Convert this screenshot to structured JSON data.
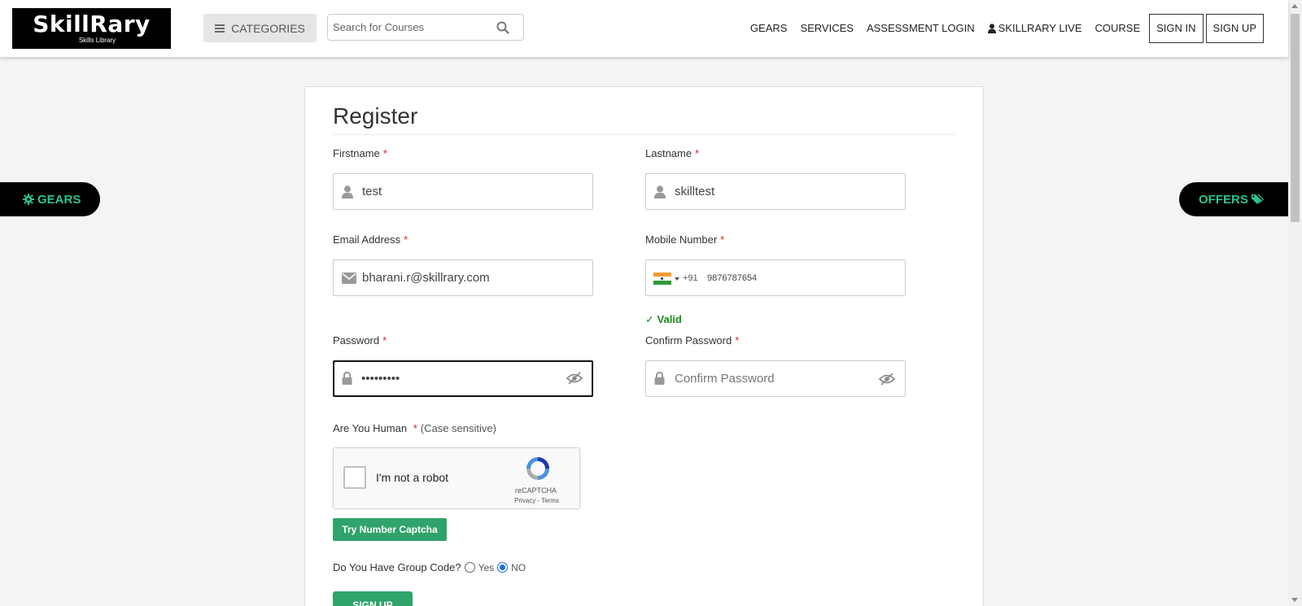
{
  "header": {
    "logo_text": "SkillRary",
    "logo_tagline": "Skills Library",
    "categories_label": "CATEGORIES",
    "search_placeholder": "Search for Courses",
    "nav": {
      "gears": "GEARS",
      "services": "SERVICES",
      "assessment": "ASSESSMENT LOGIN",
      "live": "SKILLRARY LIVE",
      "course": "COURSE",
      "signin": "SIGN IN",
      "signup": "SIGN UP"
    }
  },
  "side": {
    "left_label": "GEARS",
    "right_label": "OFFERS"
  },
  "form": {
    "title": "Register",
    "required_mark": "*",
    "firstname": {
      "label": "Firstname",
      "value": "test"
    },
    "lastname": {
      "label": "Lastname",
      "value": "skilltest"
    },
    "email": {
      "label": "Email Address",
      "value": "bharani.r@skillrary.com"
    },
    "mobile": {
      "label": "Mobile Number",
      "dial_code": "+91",
      "value": "9876787654",
      "status": "✓ Valid"
    },
    "password": {
      "label": "Password",
      "value": "•••••••••"
    },
    "confirm_password": {
      "label": "Confirm Password",
      "placeholder": "Confirm Password"
    },
    "captcha": {
      "label": "Are You Human",
      "hint": "(Case sensitive)",
      "checkbox_text": "I'm not a robot",
      "brand": "reCAPTCHA",
      "terms": "Privacy - Terms"
    },
    "try_number_captcha": "Try Number Captcha",
    "group_code": {
      "label": "Do You Have Group Code?",
      "yes": "Yes",
      "no": "NO",
      "selected": "NO"
    },
    "submit": "SIGN UP"
  },
  "colors": {
    "accent_green": "#2fa36b",
    "side_text_green": "#2bc38a",
    "required_red": "#e02020",
    "valid_green": "#1a8a1a"
  },
  "icons": [
    "bars-icon",
    "search-icon",
    "user-icon",
    "envelope-icon",
    "lock-icon",
    "eye-slash-icon",
    "cog-icon",
    "tags-icon",
    "india-flag-icon",
    "recaptcha-icon"
  ]
}
